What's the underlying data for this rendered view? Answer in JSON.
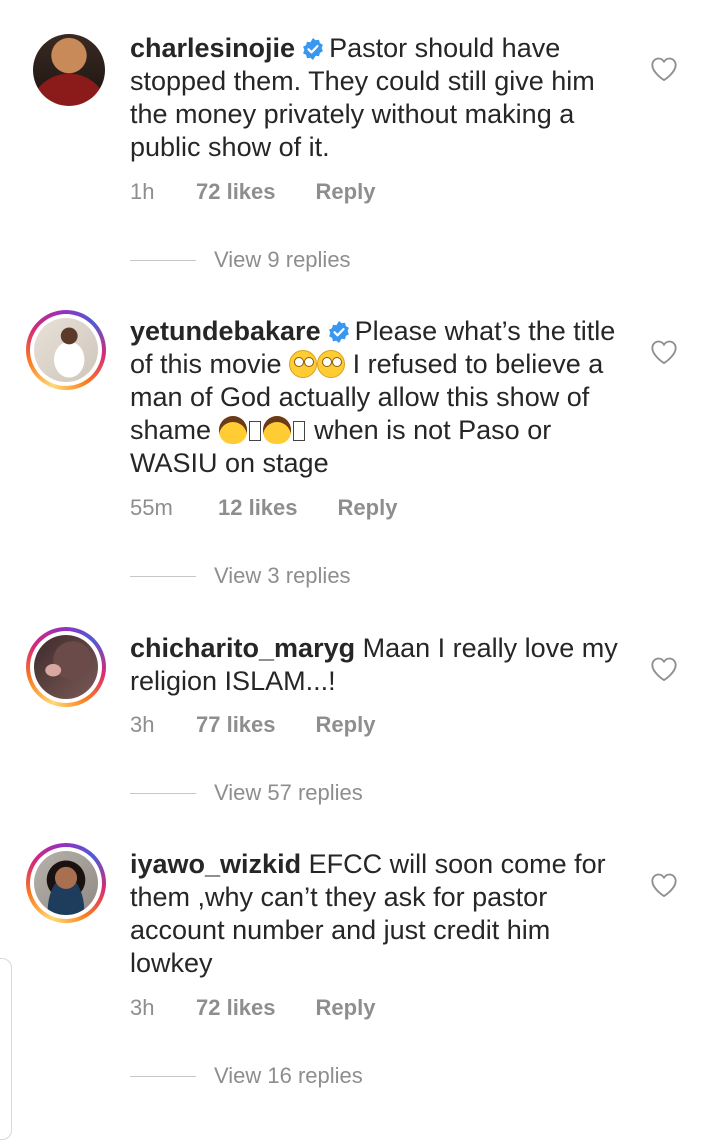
{
  "comments": [
    {
      "username": "charlesinojie",
      "verified": true,
      "text": "Pastor should have stopped them. They could still give him the money privately without making a public show of it.",
      "time": "1h",
      "likes": "72 likes",
      "reply": "Reply",
      "view_replies": "View 9 replies",
      "avatar_ring": false
    },
    {
      "username": "yetundebakare",
      "verified": true,
      "text_before_emoji": "Please what’s the title of this movie",
      "text_mid": "I refused to believe a man of God actually allow this show of shame",
      "text_after": "when is not Paso or WASIU on stage",
      "time": "55m",
      "likes": "12 likes",
      "reply": "Reply",
      "view_replies": "View 3 replies",
      "avatar_ring": true
    },
    {
      "username": "chicharito_maryg",
      "verified": false,
      "text": "Maan I really love my religion ISLAM...!",
      "time": "3h",
      "likes": "77 likes",
      "reply": "Reply",
      "view_replies": "View 57 replies",
      "avatar_ring": true
    },
    {
      "username": "iyawo_wizkid",
      "verified": false,
      "text": "EFCC will soon come for them ,why can’t they ask for pastor account number and just credit him lowkey",
      "time": "3h",
      "likes": "72 likes",
      "reply": "Reply",
      "view_replies": "View 16 replies",
      "avatar_ring": true
    }
  ],
  "colors": {
    "text": "#262626",
    "muted": "#8e8e8e",
    "verified_blue": "#3897f0",
    "story_ring": [
      "#feda75",
      "#fa7e1e",
      "#d62976",
      "#962fbf",
      "#4f5bd5"
    ]
  },
  "icons": {
    "like": "heart-outline-icon",
    "verified": "verified-badge-icon"
  }
}
